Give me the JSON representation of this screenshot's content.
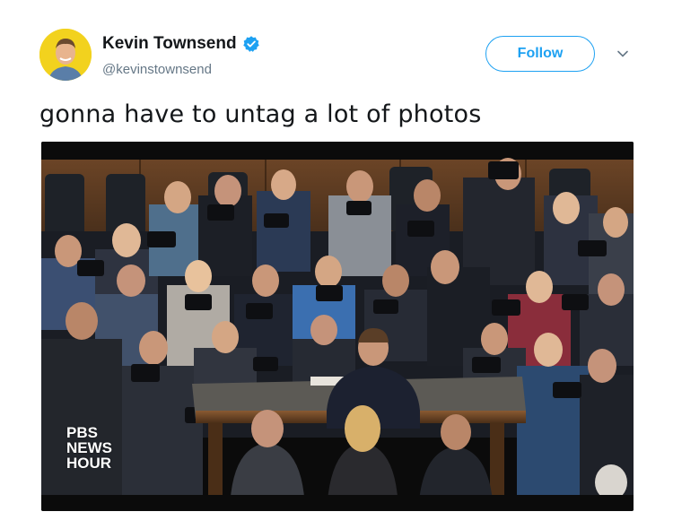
{
  "tweet": {
    "author": {
      "display_name": "Kevin Townsend",
      "handle": "@kevinstownsend",
      "verified": true,
      "avatar_bg": "#f2d21e"
    },
    "follow_label": "Follow",
    "text": "gonna have to untag a lot of photos",
    "media": {
      "watermark_lines": [
        "PBS",
        "NEWS",
        "HOUR"
      ]
    }
  },
  "colors": {
    "accent": "#1da1f2",
    "text_primary": "#14171a",
    "text_secondary": "#657786"
  }
}
